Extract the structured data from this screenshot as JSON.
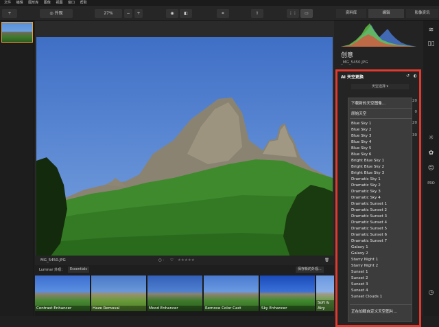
{
  "menubar": [
    "文件",
    "编辑",
    "图形库",
    "图像",
    "视图",
    "窗口",
    "帮助"
  ],
  "toolbar": {
    "add_label": "+",
    "look_label": "外观",
    "zoom": "27%",
    "zoom_minus": "−",
    "zoom_plus": "+"
  },
  "right_tabs": {
    "library": "资料库",
    "edit": "编辑",
    "info": "影像资讯"
  },
  "panel": {
    "title": "创意",
    "filename": "_MG_5450.JPG",
    "ai_title": "AI 天空更换",
    "sky_select_label": "天空选择 ▾"
  },
  "sky_menu": {
    "download": "下载新的天空图像...",
    "original": "原始天空",
    "items": [
      "Blue Sky 1",
      "Blue Sky 2",
      "Blue Sky 3",
      "Blue Sky 4",
      "Blue Sky 5",
      "Blue Sky 6",
      "Bright Blue Sky 1",
      "Bright Blue Sky 2",
      "Bright Blue Sky 3",
      "Dramatic Sky 1",
      "Dramatic Sky 2",
      "Dramatic Sky 3",
      "Dramatic Sky 4",
      "Dramatic Sunset 1",
      "Dramatic Sunset 2",
      "Dramatic Sunset 3",
      "Dramatic Sunset 4",
      "Dramatic Sunset 5",
      "Dramatic Sunset 6",
      "Dramatic Sunset 7",
      "Galaxy 1",
      "Galaxy 2",
      "Starry Night 1",
      "Starry Night 2",
      "Sunset 1",
      "Sunset 2",
      "Sunset 3",
      "Sunset 4",
      "Sunset Clouds 1"
    ],
    "load_custom": "正在加载自定义天空图片..."
  },
  "side_values": [
    "20",
    "0",
    "20",
    "30"
  ],
  "infobar": {
    "filename": "MG_5450.JPG",
    "rating_stars": "★★★★★",
    "flag": "○ ·",
    "heart": "♡"
  },
  "looksbar": {
    "label": "Luminar 外观：",
    "category": "Essentials",
    "save_label": "保存新的外观..."
  },
  "looks": [
    "Contrast Enhancer",
    "Haze Removal",
    "Mood Enhancer",
    "Remove Color Cast",
    "Sky Enhancer",
    "Soft & Airy"
  ],
  "colors": {
    "accent_highlight": "#e23a2f",
    "selection": "#e6a33a",
    "sky": "#4a78c8"
  }
}
